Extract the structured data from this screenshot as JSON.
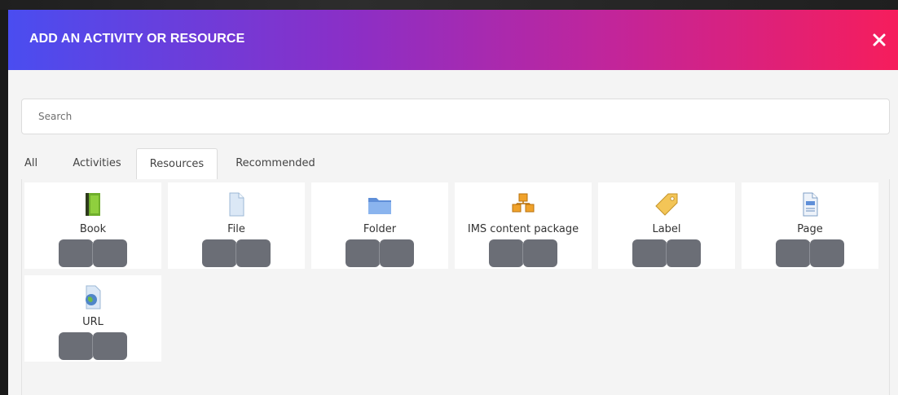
{
  "modal": {
    "title": "ADD AN ACTIVITY OR RESOURCE",
    "close_icon": "close-icon"
  },
  "search": {
    "placeholder": "Search",
    "value": ""
  },
  "tabs": [
    {
      "label": "All",
      "active": false
    },
    {
      "label": "Activities",
      "active": false
    },
    {
      "label": "Resources",
      "active": true
    },
    {
      "label": "Recommended",
      "active": false
    }
  ],
  "resources": [
    {
      "label": "Book",
      "icon": "book-icon"
    },
    {
      "label": "File",
      "icon": "file-icon"
    },
    {
      "label": "Folder",
      "icon": "folder-icon"
    },
    {
      "label": "IMS content package",
      "icon": "ims-package-icon"
    },
    {
      "label": "Label",
      "icon": "label-icon"
    },
    {
      "label": "Page",
      "icon": "page-icon"
    },
    {
      "label": "URL",
      "icon": "url-icon"
    }
  ],
  "colors": {
    "header_gradient_start": "#4a4df0",
    "header_gradient_end": "#f61d5c",
    "tile_button": "#6b6e76"
  }
}
